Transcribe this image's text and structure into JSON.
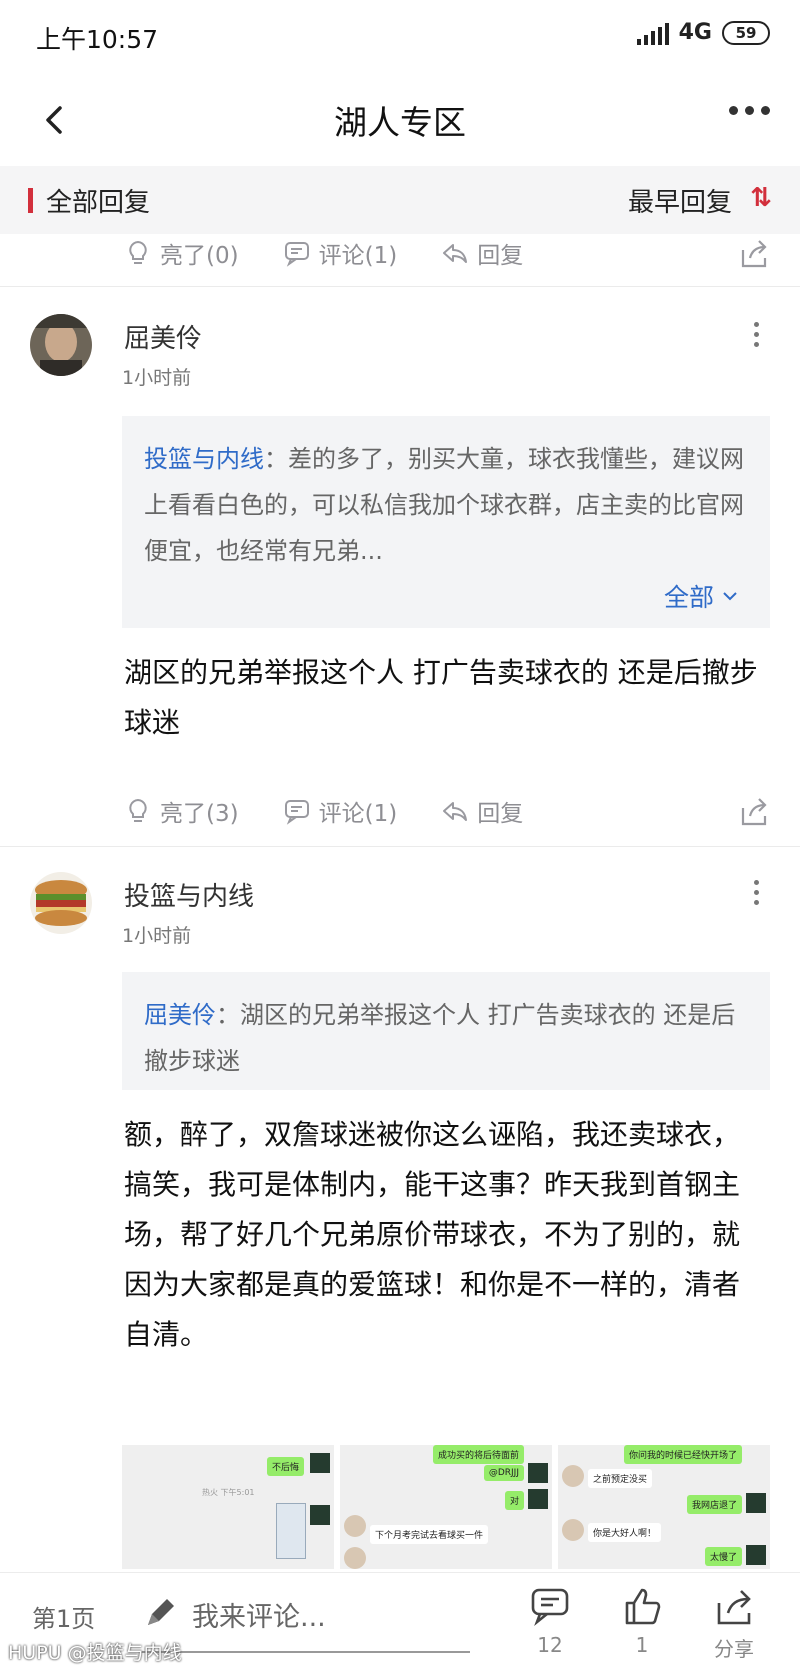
{
  "status": {
    "time": "上午10:57",
    "network": "4G",
    "battery": "59"
  },
  "nav": {
    "title": "湖人专区"
  },
  "subheader": {
    "all_replies": "全部回复",
    "sort": "最早回复"
  },
  "top_actions": {
    "like": "亮了(0)",
    "comment": "评论(1)",
    "reply": "回复"
  },
  "comments": [
    {
      "user": "屈美伶",
      "time": "1小时前",
      "quote_user": "投篮与内线",
      "quote_text": "：差的多了，别买大童，球衣我懂些，建议网上看看白色的，可以私信我加个球衣群，店主卖的比官网便宜，也经常有兄弟...",
      "expand": "全部",
      "body": "湖区的兄弟举报这个人 打广告卖球衣的 还是后撤步球迷",
      "like": "亮了(3)",
      "comment": "评论(1)",
      "reply": "回复"
    },
    {
      "user": "投篮与内线",
      "time": "1小时前",
      "quote_user": "屈美伶",
      "quote_text": "：湖区的兄弟举报这个人 打广告卖球衣的 还是后撤步球迷",
      "body": "额，醉了，双詹球迷被你这么诬陷，我还卖球衣，搞笑，我可是体制内，能干这事？昨天我到首钢主场，帮了好几个兄弟原价带球衣，不为了别的，就因为大家都是真的爱篮球！和你是不一样的，清者自清。"
    }
  ],
  "screenshots": {
    "a": [
      "不后悔",
      "热火 下午5:01"
    ],
    "b": [
      "成功买的将后待面前",
      "@DRJJJ",
      "对",
      "下个月考完试去看球买一件"
    ],
    "c": [
      "你问我的时候已经快开场了",
      "之前预定没买",
      "我网店退了",
      "你是大好人啊！",
      "太慢了"
    ]
  },
  "bottom": {
    "page": "第1页",
    "input_placeholder": "我来评论...",
    "comment_count": "12",
    "like_count": "1",
    "share": "分享"
  },
  "watermark": "HUPU @投篮与内线",
  "colors": {
    "accent_red": "#d22f3c",
    "link_blue": "#2f6bc8",
    "gray_text": "#8e8e93"
  }
}
